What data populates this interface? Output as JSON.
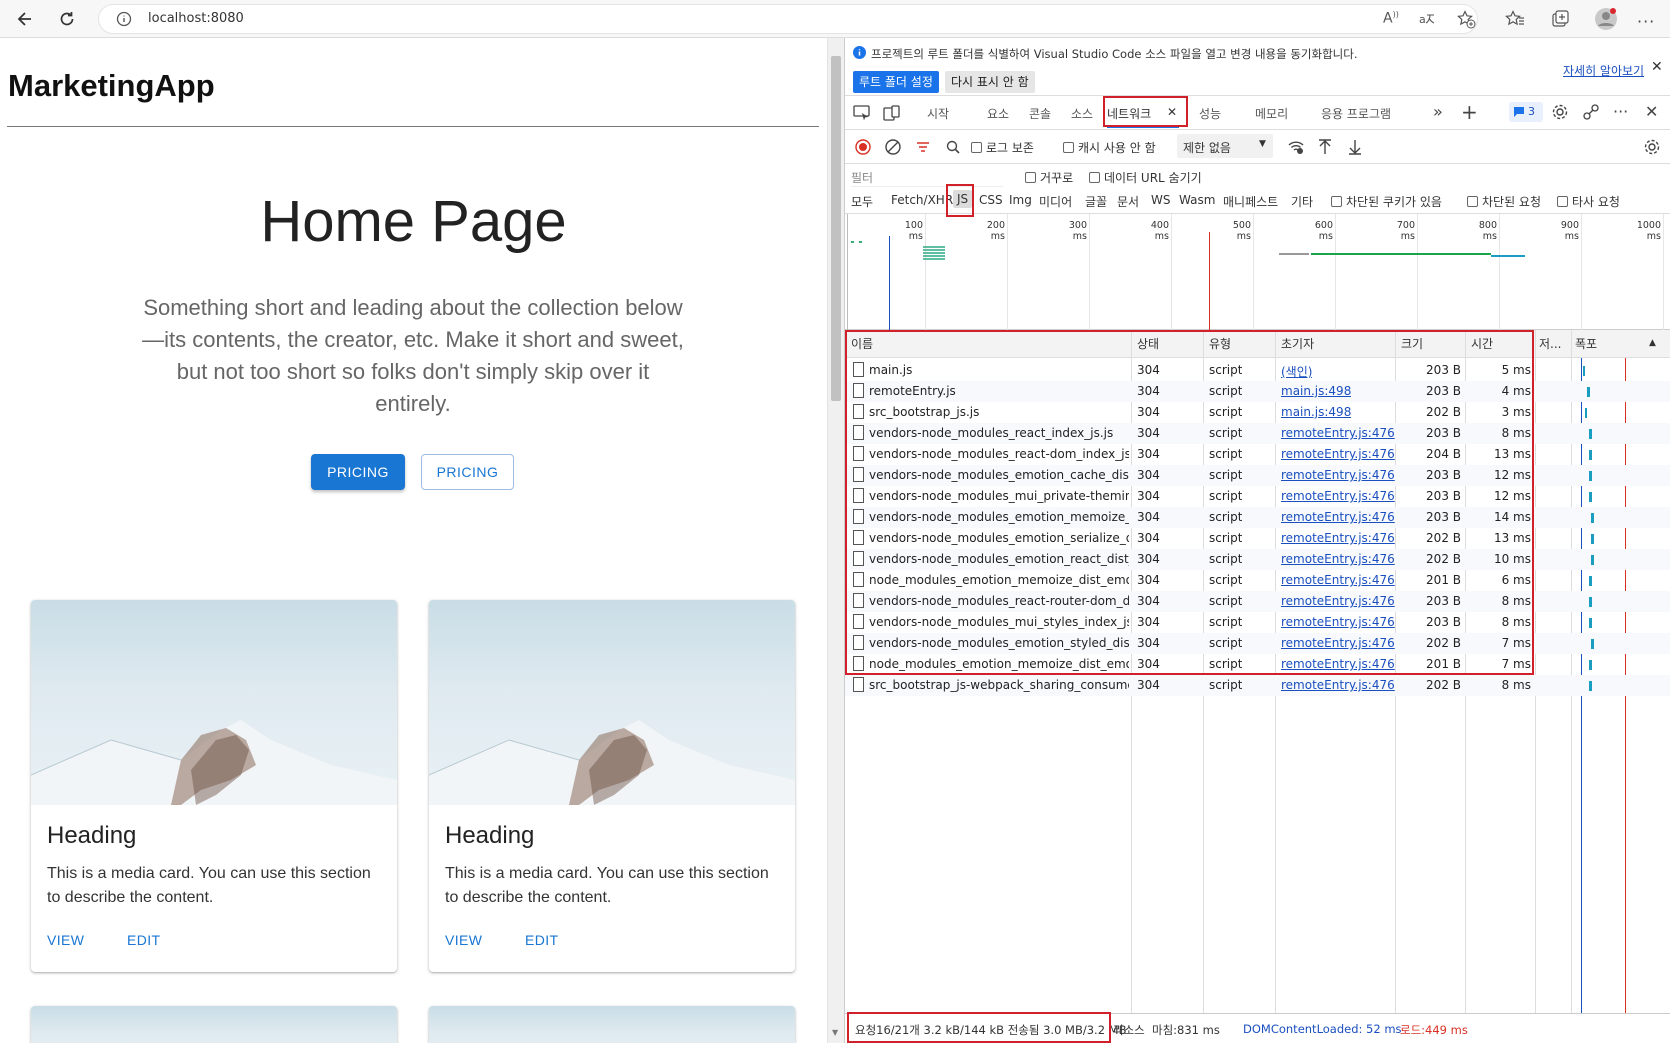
{
  "browser": {
    "url": "localhost:8080"
  },
  "page": {
    "brand": "MarketingApp",
    "hero_title": "Home Page",
    "hero_text": "Something short and leading about the collection below—its contents, the creator, etc. Make it short and sweet, but not too short so folks don't simply skip over it entirely.",
    "btn_primary": "PRICING",
    "btn_secondary": "PRICING",
    "cards": [
      {
        "heading": "Heading",
        "text": "This is a media card. You can use this section to describe the content.",
        "view": "VIEW",
        "edit": "EDIT"
      },
      {
        "heading": "Heading",
        "text": "This is a media card. You can use this section to describe the content.",
        "view": "VIEW",
        "edit": "EDIT"
      }
    ]
  },
  "devtools": {
    "info_text": "프로젝트의 루트 폴더를 식별하여 Visual Studio Code 소스 파일을 열고 변경 내용을 동기화합니다.",
    "info_link": "자세히 알아보기",
    "btn_set_root": "루트 폴더 설정",
    "btn_dont_show": "다시 표시 안 함",
    "tabs": [
      "시작",
      "요소",
      "콘솔",
      "소스",
      "네트워크",
      "성능",
      "메모리",
      "응용 프로그램"
    ],
    "issues_count": "3",
    "toolbar": {
      "preserve_log": "로그 보존",
      "disable_cache": "캐시 사용 안 함",
      "throttle": "제한 없음"
    },
    "filter_placeholder": "필터",
    "filter_invert": "거꾸로",
    "filter_hide_data": "데이터 URL 숨기기",
    "types": [
      "모두",
      "Fetch/XHR",
      "JS",
      "CSS",
      "Img",
      "미디어",
      "글꼴",
      "문서",
      "WS",
      "Wasm",
      "매니페스트",
      "기타"
    ],
    "type_blocked_cookies": "차단된 쿠키가 있음",
    "type_blocked_requests": "차단된 요청",
    "type_third_party": "타사 요청",
    "timeline_ticks": [
      "100 ms",
      "200 ms",
      "300 ms",
      "400 ms",
      "500 ms",
      "600 ms",
      "700 ms",
      "800 ms",
      "900 ms",
      "1000 ms"
    ],
    "columns": [
      "이름",
      "상태",
      "유형",
      "초기자",
      "크기",
      "시간",
      "저...",
      "폭포"
    ],
    "rows": [
      {
        "name": "main.js",
        "status": "304",
        "type": "script",
        "initiator": "(색인)",
        "size": "203 B",
        "time": "5 ms"
      },
      {
        "name": "remoteEntry.js",
        "status": "304",
        "type": "script",
        "initiator": "main.js:498",
        "size": "203 B",
        "time": "4 ms"
      },
      {
        "name": "src_bootstrap_js.js",
        "status": "304",
        "type": "script",
        "initiator": "main.js:498",
        "size": "202 B",
        "time": "3 ms"
      },
      {
        "name": "vendors-node_modules_react_index_js.js",
        "status": "304",
        "type": "script",
        "initiator": "remoteEntry.js:476",
        "size": "203 B",
        "time": "8 ms"
      },
      {
        "name": "vendors-node_modules_react-dom_index_js.js",
        "status": "304",
        "type": "script",
        "initiator": "remoteEntry.js:476",
        "size": "204 B",
        "time": "13 ms"
      },
      {
        "name": "vendors-node_modules_emotion_cache_dist_e...",
        "status": "304",
        "type": "script",
        "initiator": "remoteEntry.js:476",
        "size": "203 B",
        "time": "12 ms"
      },
      {
        "name": "vendors-node_modules_mui_private-theming_...",
        "status": "304",
        "type": "script",
        "initiator": "remoteEntry.js:476",
        "size": "203 B",
        "time": "12 ms"
      },
      {
        "name": "vendors-node_modules_emotion_memoize_dis...",
        "status": "304",
        "type": "script",
        "initiator": "remoteEntry.js:476",
        "size": "203 B",
        "time": "14 ms"
      },
      {
        "name": "vendors-node_modules_emotion_serialize_dist...",
        "status": "304",
        "type": "script",
        "initiator": "remoteEntry.js:476",
        "size": "202 B",
        "time": "13 ms"
      },
      {
        "name": "vendors-node_modules_emotion_react_dist_e...",
        "status": "304",
        "type": "script",
        "initiator": "remoteEntry.js:476",
        "size": "202 B",
        "time": "10 ms"
      },
      {
        "name": "node_modules_emotion_memoize_dist_emotio...",
        "status": "304",
        "type": "script",
        "initiator": "remoteEntry.js:476",
        "size": "201 B",
        "time": "6 ms"
      },
      {
        "name": "vendors-node_modules_react-router-dom_dist...",
        "status": "304",
        "type": "script",
        "initiator": "remoteEntry.js:476",
        "size": "203 B",
        "time": "8 ms"
      },
      {
        "name": "vendors-node_modules_mui_styles_index_js.js",
        "status": "304",
        "type": "script",
        "initiator": "remoteEntry.js:476",
        "size": "203 B",
        "time": "8 ms"
      },
      {
        "name": "vendors-node_modules_emotion_styled_dist_e...",
        "status": "304",
        "type": "script",
        "initiator": "remoteEntry.js:476",
        "size": "202 B",
        "time": "7 ms"
      },
      {
        "name": "node_modules_emotion_memoize_dist_emotio...",
        "status": "304",
        "type": "script",
        "initiator": "remoteEntry.js:476",
        "size": "201 B",
        "time": "7 ms"
      },
      {
        "name": "src_bootstrap_js-webpack_sharing_consume_d...",
        "status": "304",
        "type": "script",
        "initiator": "remoteEntry.js:476",
        "size": "202 B",
        "time": "8 ms"
      }
    ],
    "status": {
      "summary": "요청16/21개  3.2 kB/144 kB 전송됨  3.0 MB/3.2 MB",
      "resources_suffix": "리소스",
      "finish": "마침:831 ms",
      "dcl": "DOMContentLoaded: 52 ms",
      "load": "로드:449 ms"
    },
    "colors": {
      "accent": "#1a73e8",
      "dcl": "#1a4fbf",
      "load": "#d93025",
      "highlight": "#d0202a"
    }
  }
}
